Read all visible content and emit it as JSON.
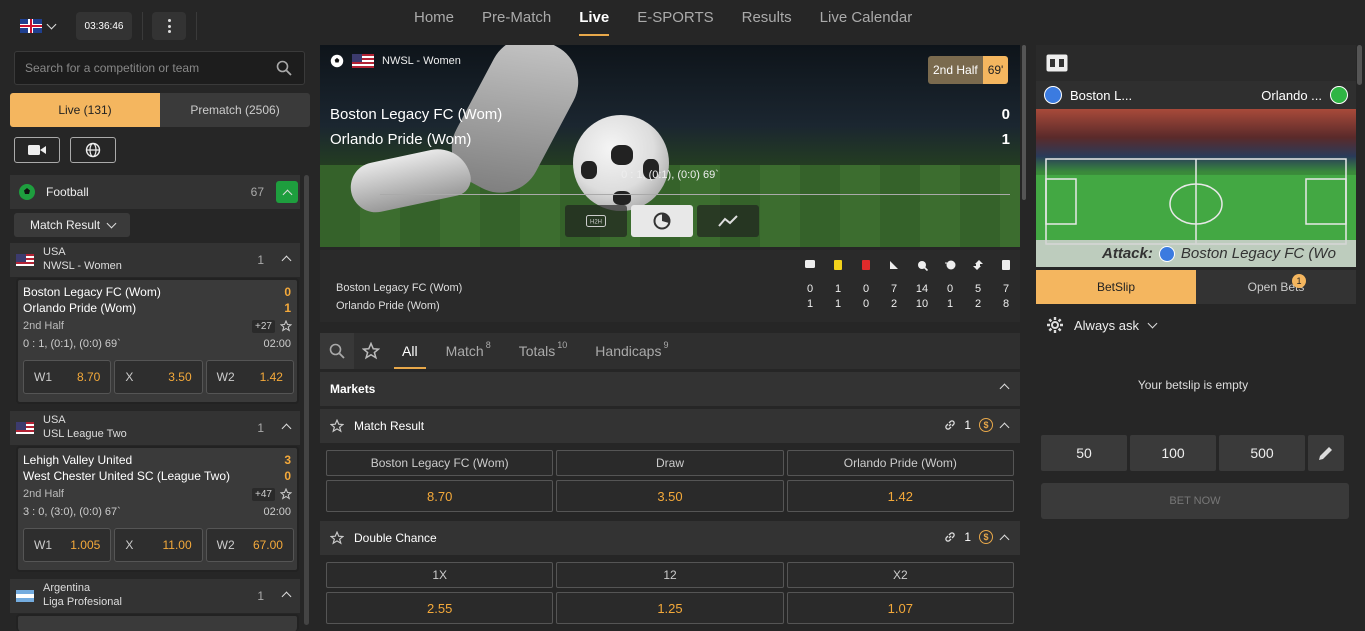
{
  "topbar": {
    "clock": "03:36:46",
    "nav": [
      "Home",
      "Pre-Match",
      "Live",
      "E-SPORTS",
      "Results",
      "Live Calendar"
    ],
    "active_nav": "Live"
  },
  "sidebar": {
    "search_placeholder": "Search for a competition or team",
    "tab_live": "Live (131)",
    "tab_prematch": "Prematch (2506)",
    "sport": {
      "name": "Football",
      "count": "67"
    },
    "market_dropdown": "Match Result",
    "leagues": [
      {
        "country": "USA",
        "name": "NWSL - Women",
        "count": "1"
      },
      {
        "country": "USA",
        "name": "USL League Two",
        "count": "1"
      },
      {
        "country": "Argentina",
        "name": "Liga Profesional",
        "count": "1"
      }
    ],
    "matches": [
      {
        "team1": "Boston Legacy FC (Wom)",
        "team2": "Orlando Pride (Wom)",
        "score1": "0",
        "score2": "1",
        "period": "2nd Half",
        "more": "+27",
        "detail": "0 : 1, (0:1), (0:0) 69`",
        "time": "02:00",
        "odds": [
          {
            "label": "W1",
            "value": "8.70"
          },
          {
            "label": "X",
            "value": "3.50"
          },
          {
            "label": "W2",
            "value": "1.42"
          }
        ]
      },
      {
        "team1": "Lehigh Valley United",
        "team2": "West Chester United SC (League Two)",
        "score1": "3",
        "score2": "0",
        "period": "2nd Half",
        "more": "+47",
        "detail": "3 : 0, (3:0), (0:0) 67`",
        "time": "02:00",
        "odds": [
          {
            "label": "W1",
            "value": "1.005"
          },
          {
            "label": "X",
            "value": "11.00"
          },
          {
            "label": "W2",
            "value": "67.00"
          }
        ]
      }
    ]
  },
  "event": {
    "competition": "NWSL - Women",
    "period": "2nd Half",
    "minute": "69'",
    "team1": "Boston Legacy FC (Wom)",
    "team2": "Orlando Pride (Wom)",
    "score1": "0",
    "score2": "1",
    "score_detail": "0 : 1, (0:1), (0:0) 69`",
    "h2h_label": "H2H",
    "stats": {
      "team1": "Boston Legacy FC (Wom)",
      "team2": "Orlando Pride (Wom)",
      "row1": [
        "0",
        "1",
        "0",
        "7",
        "14",
        "0",
        "5",
        "7"
      ],
      "row2": [
        "1",
        "1",
        "0",
        "2",
        "10",
        "1",
        "2",
        "8"
      ]
    }
  },
  "markets": {
    "tabs": [
      {
        "label": "All",
        "count": ""
      },
      {
        "label": "Match",
        "count": "8"
      },
      {
        "label": "Totals",
        "count": "10"
      },
      {
        "label": "Handicaps",
        "count": "9"
      }
    ],
    "header": "Markets",
    "groups": [
      {
        "title": "Match Result",
        "links": "1",
        "outcomes": [
          "Boston Legacy FC (Wom)",
          "Draw",
          "Orlando Pride (Wom)"
        ],
        "values": [
          "8.70",
          "3.50",
          "1.42"
        ]
      },
      {
        "title": "Double Chance",
        "links": "1",
        "outcomes": [
          "1X",
          "12",
          "X2"
        ],
        "values": [
          "2.55",
          "1.25",
          "1.07"
        ]
      }
    ]
  },
  "tracker": {
    "team1": "Boston L...",
    "team2": "Orlando ...",
    "attack_label": "Attack:",
    "attack_team": "Boston Legacy FC (Wo"
  },
  "betslip": {
    "tab_betslip": "BetSlip",
    "tab_open": "Open Bets",
    "open_count": "1",
    "mode": "Always ask",
    "empty_text": "Your betslip is empty",
    "stakes": [
      "50",
      "100",
      "500"
    ],
    "bet_now": "BET NOW"
  },
  "colors": {
    "accent": "#f4b65f",
    "odds": "#f4a93a",
    "green": "#1e9e3e"
  }
}
